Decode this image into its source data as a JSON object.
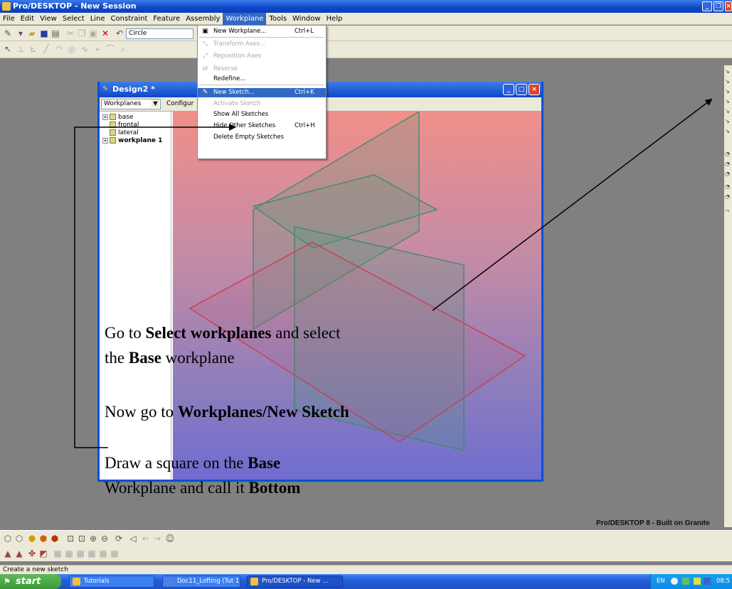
{
  "app": {
    "title": "Pro/DESKTOP - New Session",
    "menus": [
      "File",
      "Edit",
      "View",
      "Select",
      "Line",
      "Constraint",
      "Feature",
      "Assembly",
      "Workplane",
      "Tools",
      "Window",
      "Help"
    ],
    "active_menu": "Workplane",
    "line_style_combo": "Circle",
    "brand_text": "Pro/DESKTOP 8 - Built on Granite",
    "status_text": "Create a new sketch"
  },
  "design_window": {
    "title": "Design2 *",
    "browser_combo": "Workplanes",
    "config_label": "Configur",
    "tree": [
      {
        "label": "base",
        "bold": false,
        "expandable": true
      },
      {
        "label": "frontal",
        "bold": false,
        "expandable": false
      },
      {
        "label": "lateral",
        "bold": false,
        "expandable": false
      },
      {
        "label": "workplane 1",
        "bold": true,
        "expandable": true
      }
    ]
  },
  "workplane_menu": {
    "items": [
      {
        "label": "New Workplane...",
        "shortcut": "Ctrl+L",
        "disabled": false,
        "highlight": false,
        "icon": "new-workplane-icon"
      },
      {
        "label": "Transform Axes...",
        "shortcut": "",
        "disabled": true,
        "highlight": false,
        "icon": "transform-axes-icon"
      },
      {
        "label": "Reposition Axes",
        "shortcut": "",
        "disabled": true,
        "highlight": false,
        "icon": "reposition-axes-icon"
      },
      {
        "label": "Reverse",
        "shortcut": "",
        "disabled": true,
        "highlight": false,
        "icon": "reverse-icon"
      },
      {
        "label": "Redefine...",
        "shortcut": "",
        "disabled": false,
        "highlight": false,
        "icon": ""
      },
      {
        "label": "New Sketch...",
        "shortcut": "Ctrl+K",
        "disabled": false,
        "highlight": true,
        "icon": "new-sketch-icon"
      },
      {
        "label": "Activate Sketch",
        "shortcut": "",
        "disabled": true,
        "highlight": false,
        "icon": ""
      },
      {
        "label": "Show All Sketches",
        "shortcut": "",
        "disabled": false,
        "highlight": false,
        "icon": ""
      },
      {
        "label": "Hide Other Sketches",
        "shortcut": "Ctrl+H",
        "disabled": false,
        "highlight": false,
        "icon": ""
      },
      {
        "label": "Delete Empty Sketches",
        "shortcut": "",
        "disabled": false,
        "highlight": false,
        "icon": ""
      }
    ]
  },
  "annotations": {
    "note1_pre": "Go to ",
    "note1_bold1": "Select workplanes",
    "note1_mid": " and select",
    "note1_line2_pre": "the ",
    "note1_bold2": "Base",
    "note1_post": " workplane",
    "note2_pre": "Now go to ",
    "note2_bold": "Workplanes/New Sketch",
    "note3_pre": "Draw a square on the ",
    "note3_bold1": "Base",
    "note3_line2_pre": "Workplane and call it ",
    "note3_bold2": "Bottom"
  },
  "taskbar": {
    "start_label": "start",
    "tasks": [
      {
        "label": "Tutorials",
        "active": false
      },
      {
        "label": "Doc11_Lofting (Tut 1...",
        "active": false
      },
      {
        "label": "Pro/DESKTOP - New ...",
        "active": true
      }
    ],
    "tray_lang": "EN",
    "clock": "08:5"
  }
}
